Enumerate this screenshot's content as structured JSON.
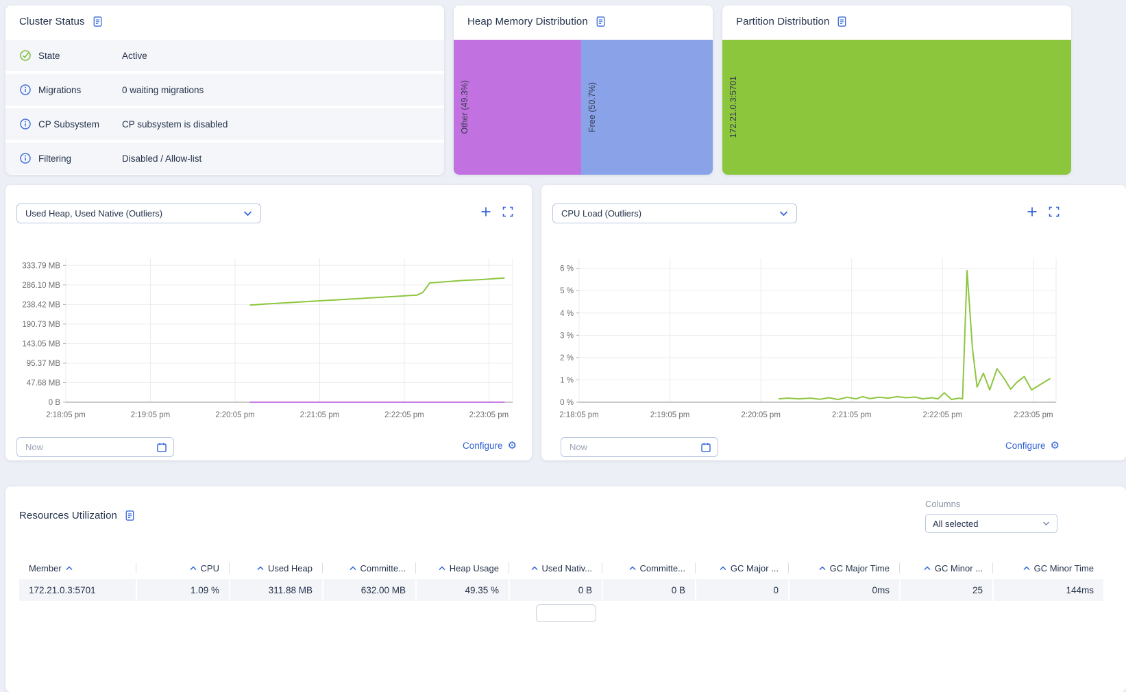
{
  "accent_color": "#2f62d8",
  "cluster_status": {
    "title": "Cluster Status",
    "rows": [
      {
        "icon": "check-circle",
        "label": "State",
        "value": "Active"
      },
      {
        "icon": "info-circle",
        "label": "Migrations",
        "value": "0 waiting migrations"
      },
      {
        "icon": "info-circle",
        "label": "CP Subsystem",
        "value": "CP subsystem is disabled"
      },
      {
        "icon": "info-circle",
        "label": "Filtering",
        "value": "Disabled / Allow-list"
      }
    ]
  },
  "heap_distribution": {
    "title": "Heap Memory Distribution",
    "segments": [
      {
        "label": "Other (49.3%)",
        "percent": 49.3,
        "color": "#c272e0"
      },
      {
        "label": "Free (50.7%)",
        "percent": 50.7,
        "color": "#8aa3e8"
      }
    ]
  },
  "partition_distribution": {
    "title": "Partition Distribution",
    "segments": [
      {
        "label": "172.21.0.3:5701",
        "percent": 100,
        "color": "#8cc63d"
      }
    ]
  },
  "metric_panels": [
    {
      "selected_metric": "Used Heap, Used Native (Outliers)",
      "time_value": "Now",
      "configure_label": "Configure"
    },
    {
      "selected_metric": "CPU Load (Outliers)",
      "time_value": "Now",
      "configure_label": "Configure"
    }
  ],
  "resources_table": {
    "title": "Resources Utilization",
    "columns_label": "Columns",
    "columns_selected": "All selected",
    "headers": [
      "Member",
      "CPU",
      "Used Heap",
      "Committe...",
      "Heap Usage",
      "Used Nativ...",
      "Committe...",
      "GC Major ...",
      "GC Major Time",
      "GC Minor ...",
      "GC Minor Time"
    ],
    "rows": [
      [
        "172.21.0.3:5701",
        "1.09 %",
        "311.88 MB",
        "632.00 MB",
        "49.35 %",
        "0 B",
        "0 B",
        "0",
        "0ms",
        "25",
        "144ms"
      ]
    ]
  },
  "chart_data": [
    {
      "type": "line",
      "title": "Used Heap, Used Native (Outliers)",
      "x_unit": "minutes since 2:18:05 pm",
      "x_tick_labels": [
        "2:18:05 pm",
        "2:19:05 pm",
        "2:20:05 pm",
        "2:21:05 pm",
        "2:22:05 pm",
        "2:23:05 pm"
      ],
      "x_tick_values": [
        0,
        1,
        2,
        3,
        4,
        5
      ],
      "xlim": [
        0,
        5.28
      ],
      "y_tick_labels": [
        "0 B",
        "47.68 MB",
        "95.37 MB",
        "143.05 MB",
        "190.73 MB",
        "238.42 MB",
        "286.10 MB",
        "333.79 MB"
      ],
      "y_tick_values": [
        0,
        47.68,
        95.37,
        143.05,
        190.73,
        238.42,
        286.1,
        333.79
      ],
      "ylim": [
        0,
        351
      ],
      "grid": true,
      "legend": "none",
      "series": [
        {
          "name": "Used Heap",
          "unit": "MB",
          "color": "#8dc63f",
          "points": [
            [
              2.18,
              237
            ],
            [
              2.4,
              240
            ],
            [
              2.65,
              243
            ],
            [
              2.9,
              246
            ],
            [
              3.15,
              249
            ],
            [
              3.4,
              252
            ],
            [
              3.65,
              255
            ],
            [
              3.9,
              258
            ],
            [
              4.05,
              260
            ],
            [
              4.15,
              261
            ],
            [
              4.22,
              268
            ],
            [
              4.3,
              291
            ],
            [
              4.5,
              294
            ],
            [
              4.7,
              297
            ],
            [
              4.9,
              299
            ],
            [
              5.05,
              301
            ],
            [
              5.18,
              303
            ]
          ]
        },
        {
          "name": "Used Native",
          "unit": "MB",
          "color": "#c77de2",
          "points": [
            [
              2.18,
              0
            ],
            [
              5.18,
              0
            ]
          ]
        }
      ]
    },
    {
      "type": "line",
      "title": "CPU Load (Outliers)",
      "x_unit": "minutes since 2:18:05 pm",
      "x_tick_labels": [
        "2:18:05 pm",
        "2:19:05 pm",
        "2:20:05 pm",
        "2:21:05 pm",
        "2:22:05 pm",
        "2:23:05 pm"
      ],
      "x_tick_values": [
        0,
        1,
        2,
        3,
        4,
        5
      ],
      "xlim": [
        0,
        5.25
      ],
      "y_tick_labels": [
        "0 %",
        "1 %",
        "2 %",
        "3 %",
        "4 %",
        "5 %",
        "6 %"
      ],
      "y_tick_values": [
        0,
        1,
        2,
        3,
        4,
        5,
        6
      ],
      "ylim": [
        0,
        6.45
      ],
      "grid": true,
      "legend": "none",
      "series": [
        {
          "name": "CPU Load",
          "unit": "%",
          "color": "#8dc63f",
          "points": [
            [
              2.2,
              0.15
            ],
            [
              2.3,
              0.18
            ],
            [
              2.42,
              0.15
            ],
            [
              2.55,
              0.18
            ],
            [
              2.65,
              0.13
            ],
            [
              2.75,
              0.2
            ],
            [
              2.85,
              0.12
            ],
            [
              2.95,
              0.22
            ],
            [
              3.05,
              0.15
            ],
            [
              3.12,
              0.25
            ],
            [
              3.2,
              0.16
            ],
            [
              3.3,
              0.22
            ],
            [
              3.4,
              0.18
            ],
            [
              3.5,
              0.25
            ],
            [
              3.6,
              0.2
            ],
            [
              3.7,
              0.23
            ],
            [
              3.78,
              0.15
            ],
            [
              3.88,
              0.2
            ],
            [
              3.95,
              0.15
            ],
            [
              4.02,
              0.42
            ],
            [
              4.1,
              0.12
            ],
            [
              4.18,
              0.18
            ],
            [
              4.22,
              0.15
            ],
            [
              4.27,
              5.9
            ],
            [
              4.33,
              2.4
            ],
            [
              4.38,
              0.68
            ],
            [
              4.45,
              1.3
            ],
            [
              4.52,
              0.55
            ],
            [
              4.6,
              1.5
            ],
            [
              4.68,
              1.05
            ],
            [
              4.75,
              0.58
            ],
            [
              4.82,
              0.9
            ],
            [
              4.9,
              1.15
            ],
            [
              4.98,
              0.55
            ],
            [
              5.06,
              0.75
            ],
            [
              5.18,
              1.05
            ]
          ]
        }
      ]
    }
  ]
}
